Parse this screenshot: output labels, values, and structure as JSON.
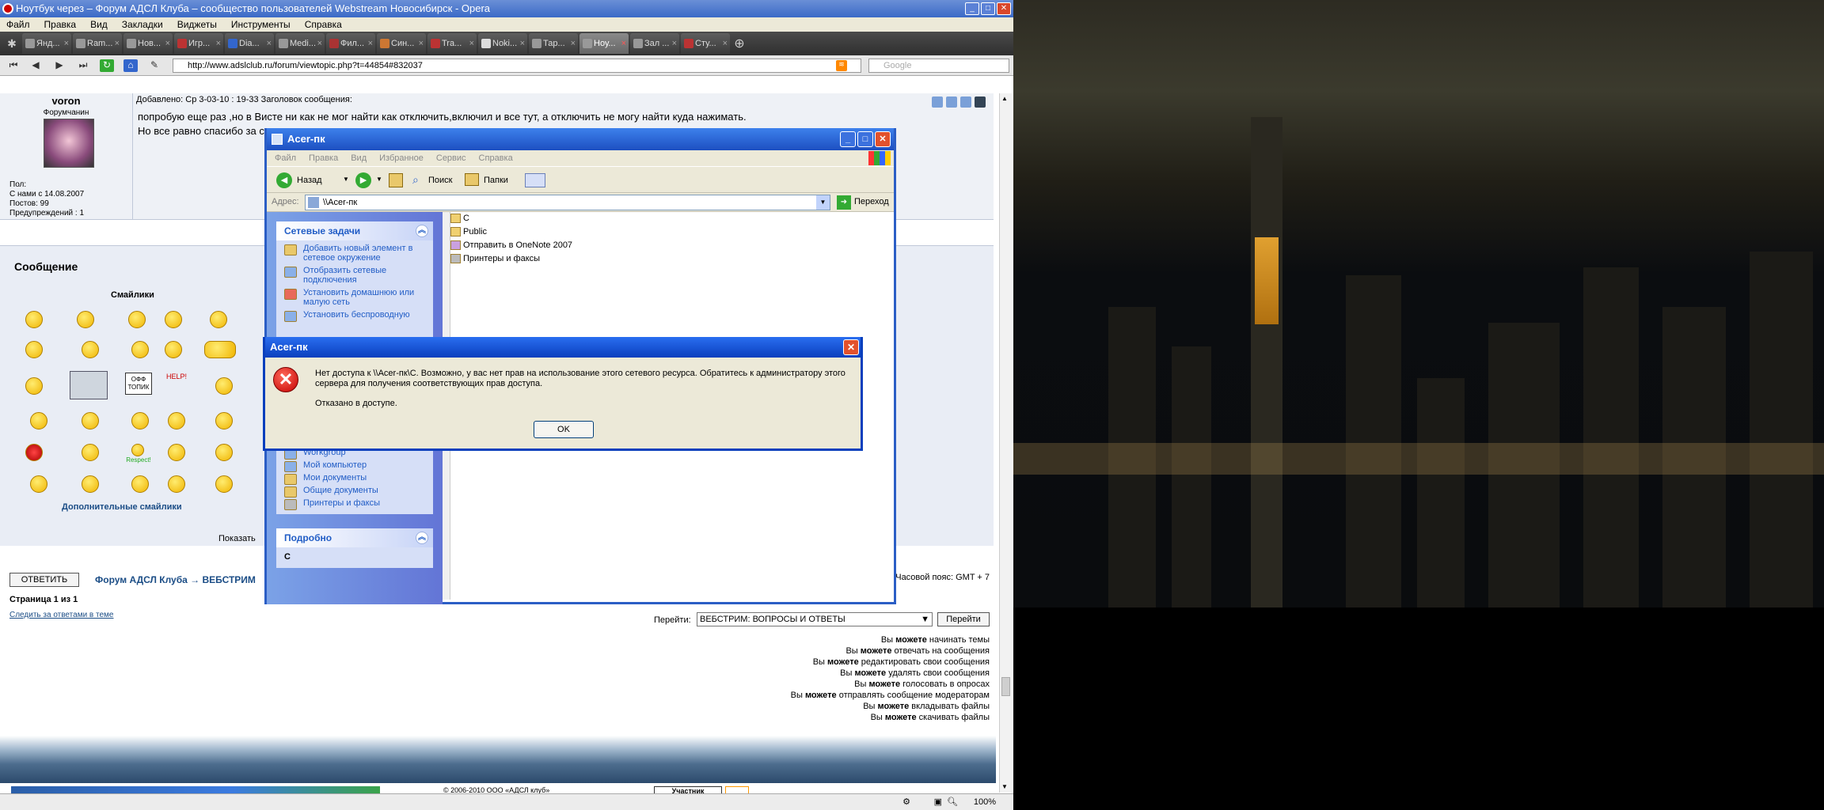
{
  "opera": {
    "title": "Ноутбук через – Форум АДСЛ Клуба – сообщество пользователей Webstream Новосибирск - Opera",
    "menu": [
      "Файл",
      "Правка",
      "Вид",
      "Закладки",
      "Виджеты",
      "Инструменты",
      "Справка"
    ],
    "tabs": [
      "Янд...",
      "Ram...",
      "Нов...",
      "Игр...",
      "Dia...",
      "Medi...",
      "Фил...",
      "Син...",
      "Tra...",
      "Noki...",
      "Тар...",
      "Ноу...",
      "Зал ...",
      "Сту..."
    ],
    "url": "http://www.adslclub.ru/forum/viewtopic.php?t=44854#832037",
    "search_placeholder": "Google",
    "zoom": "100%"
  },
  "post": {
    "author": "voron",
    "rank": "Форумчанин",
    "gender": "Пол:",
    "joined": "С нами с 14.08.2007",
    "posts": "Постов: 99",
    "warnings": "Предупреждений : 1",
    "meta": "Добавлено: Ср 3-03-10 : 19-33    Заголовок сообщения:",
    "line1": "попробую еще раз ,но в Висте ни как не мог найти как отключить,включил и все тут, а отключить не могу найти куда нажимать.",
    "line2": "Но все равно спасибо за со"
  },
  "reply": {
    "heading": "Сообщение",
    "smilies_title": "Смайлики",
    "more_smilies": "Дополнительные смайлики",
    "sticker_offtopic": "ОФФ ТОПИК",
    "sticker_help": "HELP!",
    "sticker_respect": "Respect!",
    "show_label": "Показать",
    "reply_button": "ОТВЕТИТЬ",
    "breadcrumb": "Форум АДСЛ Клуба → ВЕБСТРИМ",
    "timezone": "Часовой пояс: GMT + 7",
    "page": "Страница 1 из 1",
    "watch": "Следить за ответами в теме",
    "jump_label": "Перейти:",
    "jump_value": "ВЕБСТРИМ: ВОПРОСЫ И ОТВЕТЫ",
    "jump_button": "Перейти"
  },
  "permissions": [
    [
      "Вы ",
      "можете",
      " начинать темы"
    ],
    [
      "Вы ",
      "можете",
      " отвечать на сообщения"
    ],
    [
      "Вы ",
      "можете",
      " редактировать свои сообщения"
    ],
    [
      "Вы ",
      "можете",
      " удалять свои сообщения"
    ],
    [
      "Вы ",
      "можете",
      " голосовать в опросах"
    ],
    [
      "Вы ",
      "можете",
      " отправлять сообщение модераторам"
    ],
    [
      "Вы ",
      "можете",
      " вкладывать файлы"
    ],
    [
      "Вы ",
      "можете",
      " скачивать файлы"
    ]
  ],
  "footer": {
    "copyright": "© 2006-2010 ООО «АДСЛ клуб»",
    "badge": "Участник"
  },
  "explorer": {
    "title": "Acer-пк",
    "menu": [
      "Файл",
      "Правка",
      "Вид",
      "Избранное",
      "Сервис",
      "Справка"
    ],
    "back": "Назад",
    "search": "Поиск",
    "folders": "Папки",
    "address_label": "Адрес:",
    "address": "\\\\Acer-пк",
    "go": "Переход",
    "net_tasks_title": "Сетевые задачи",
    "net_tasks": [
      "Добавить новый элемент в сетевое окружение",
      "Отобразить сетевые подключения",
      "Установить домашнюю или малую сеть",
      "Установить беспроводную"
    ],
    "places": [
      "Workgroup",
      "Мой компьютер",
      "Мои документы",
      "Общие документы",
      "Принтеры и факсы"
    ],
    "details_title": "Подробно",
    "details_value": "C",
    "files": [
      "C",
      "Public",
      "Отправить в OneNote 2007",
      "Принтеры и факсы"
    ]
  },
  "dialog": {
    "title": "Acer-пк",
    "message": "Нет доступа к \\\\Acer-пк\\C. Возможно, у вас нет прав на использование этого сетевого ресурса. Обратитесь к администратору этого сервера для получения соответствующих прав доступа.",
    "sub": "Отказано в доступе.",
    "ok": "OK"
  }
}
